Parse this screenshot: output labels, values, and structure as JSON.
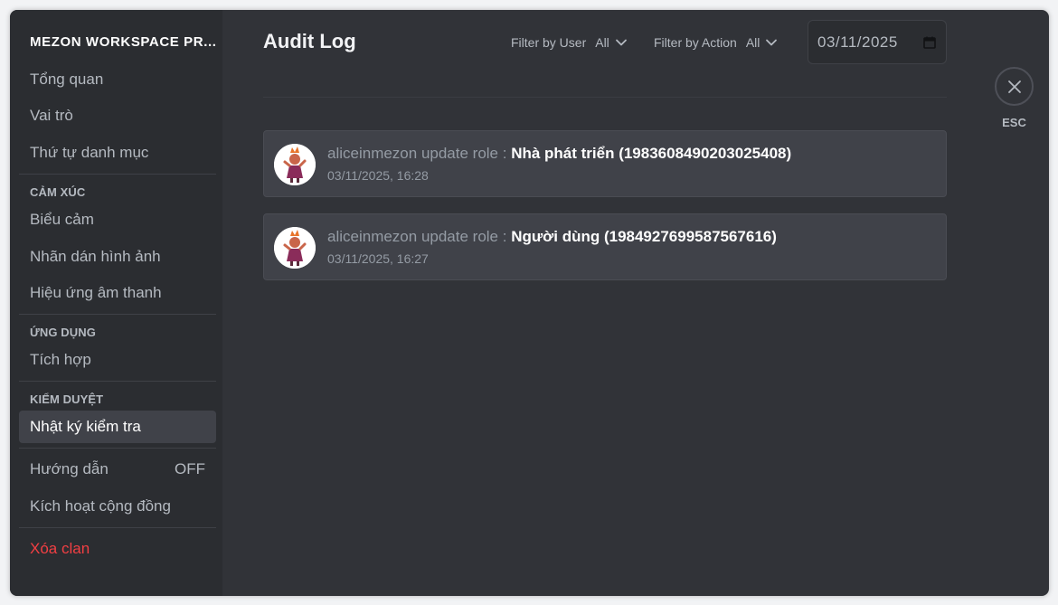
{
  "sidebar": {
    "workspace_title": "MEZON WORKSPACE PR...",
    "items": [
      {
        "label": "Tổng quan"
      },
      {
        "label": "Vai trò"
      },
      {
        "label": "Thứ tự danh mục"
      }
    ],
    "section_emoji": {
      "heading": "CẢM XÚC",
      "items": [
        {
          "label": "Biểu cảm"
        },
        {
          "label": "Nhãn dán hình ảnh"
        },
        {
          "label": "Hiệu ứng âm thanh"
        }
      ]
    },
    "section_apps": {
      "heading": "ỨNG DỤNG",
      "items": [
        {
          "label": "Tích hợp"
        }
      ]
    },
    "section_moderation": {
      "heading": "KIỂM DUYỆT",
      "items": [
        {
          "label": "Nhật ký kiểm tra"
        }
      ]
    },
    "guide": {
      "label": "Hướng dẫn",
      "status": "OFF"
    },
    "community": {
      "label": "Kích hoạt cộng đồng"
    },
    "delete": {
      "label": "Xóa clan"
    }
  },
  "main": {
    "title": "Audit Log",
    "filter_user": {
      "label": "Filter by User",
      "value": "All"
    },
    "filter_action": {
      "label": "Filter by Action",
      "value": "All"
    },
    "date": {
      "value": "03/11/2025"
    },
    "entries": [
      {
        "prefix": "aliceinmezon update role : ",
        "target": "Nhà phát triển (1983608490203025408)",
        "time": "03/11/2025, 16:28"
      },
      {
        "prefix": "aliceinmezon update role : ",
        "target": "Người dùng (1984927699587567616)",
        "time": "03/11/2025, 16:27"
      }
    ]
  },
  "close": {
    "label": "ESC"
  },
  "colors": {
    "sidebar_bg": "#2b2d31",
    "content_bg": "#313338",
    "card_bg": "#404249",
    "danger": "#f23f43",
    "active_bg": "#404249"
  }
}
